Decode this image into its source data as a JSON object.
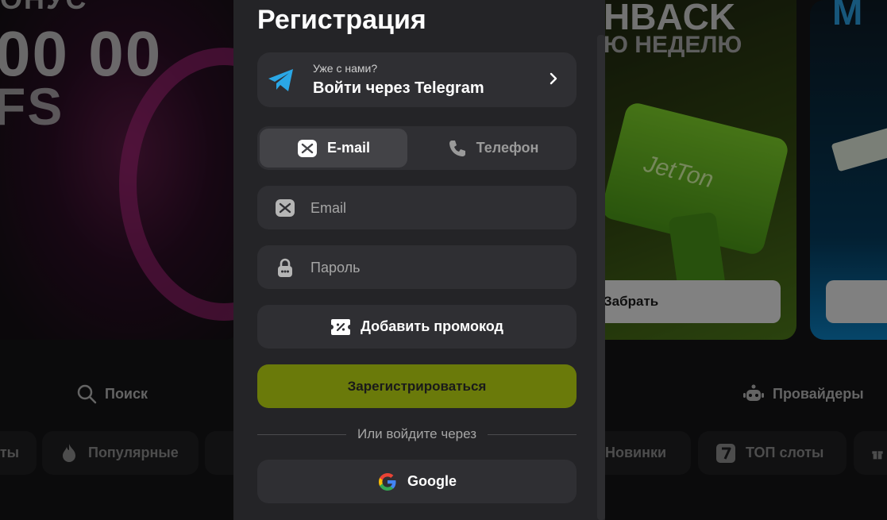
{
  "background": {
    "banner_left": {
      "line1": "ОНУС",
      "line2": "00 00",
      "line3": "FS"
    },
    "banner_mid": {
      "line1": "HBACK",
      "line2": "Ю НЕДЕЛЮ",
      "logo_text": "JetTon",
      "button": "Забрать"
    },
    "banner_right": {
      "line1": "M"
    },
    "nav": {
      "search": "Поиск",
      "providers": "Провайдеры"
    },
    "chips": [
      {
        "label": "ты",
        "icon": ""
      },
      {
        "label": "Популярные",
        "icon": "fire-icon"
      },
      {
        "label": "Новинки",
        "icon": ""
      },
      {
        "label": "ТОП слоты",
        "icon": "seven-icon"
      }
    ]
  },
  "modal": {
    "title": "Регистрация",
    "telegram": {
      "caption": "Уже с нами?",
      "label": "Войти через Telegram",
      "icon": "telegram-icon"
    },
    "tabs": [
      {
        "label": "E-mail",
        "icon": "mail-icon",
        "active": true
      },
      {
        "label": "Телефон",
        "icon": "phone-icon",
        "active": false
      }
    ],
    "email_placeholder": "Email",
    "password_placeholder": "Пароль",
    "promo_label": "Добавить промокод",
    "register_label": "Зарегистрироваться",
    "divider_text": "Или войдите через",
    "google_label": "Google",
    "accent_color": "#6a7a0a"
  }
}
